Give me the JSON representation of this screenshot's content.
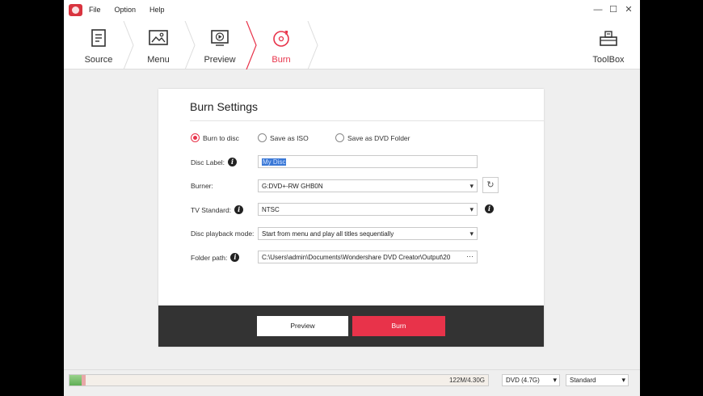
{
  "menu": {
    "file": "File",
    "option": "Option",
    "help": "Help"
  },
  "window": {
    "minimize": "—",
    "maximize": "☐",
    "close": "✕"
  },
  "steps": [
    {
      "label": "Source",
      "icon": "document-icon",
      "active": false
    },
    {
      "label": "Menu",
      "icon": "image-icon",
      "active": false
    },
    {
      "label": "Preview",
      "icon": "play-icon",
      "active": false
    },
    {
      "label": "Burn",
      "icon": "disc-burn-icon",
      "active": true
    }
  ],
  "toolbox": {
    "label": "ToolBox",
    "icon": "toolbox-icon"
  },
  "burn_settings": {
    "title": "Burn Settings",
    "output_options": [
      {
        "label": "Burn to disc",
        "checked": true
      },
      {
        "label": "Save as ISO",
        "checked": false
      },
      {
        "label": "Save as DVD Folder",
        "checked": false
      }
    ],
    "disc_label": {
      "label": "Disc Label:",
      "value": "My Disc"
    },
    "burner": {
      "label": "Burner:",
      "value": "G:DVD+-RW GHB0N"
    },
    "tv_standard": {
      "label": "TV Standard:",
      "value": "NTSC"
    },
    "playback_mode": {
      "label": "Disc playback mode:",
      "value": "Start from menu and play all titles sequentially"
    },
    "folder_path": {
      "label": "Folder path:",
      "value": "C:\\Users\\admin\\Documents\\Wondershare DVD Creator\\Output\\20",
      "browse": "···"
    },
    "preview_button": "Preview",
    "burn_button": "Burn"
  },
  "status": {
    "capacity_text": "122M/4.30G",
    "used_fraction": 0.028,
    "disc_type": "DVD (4.7G)",
    "quality": "Standard"
  },
  "colors": {
    "accent": "#e8334a",
    "footer": "#333333",
    "progress": "#5fae55"
  }
}
